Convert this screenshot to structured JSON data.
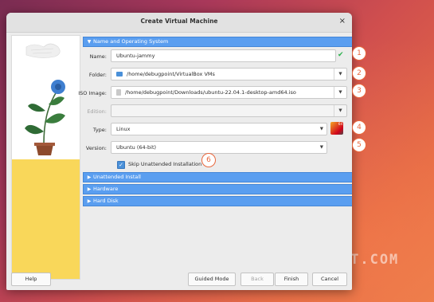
{
  "window": {
    "title": "Create Virtual Machine",
    "close_glyph": "×"
  },
  "sections": {
    "name_os": "Name and Operating System",
    "unattended": "Unattended Install",
    "hardware": "Hardware",
    "hard_disk": "Hard Disk"
  },
  "form": {
    "name_label": "Name:",
    "name_value": "Ubuntu-jammy",
    "folder_label": "Folder:",
    "folder_value": "/home/debugpoint/VirtualBox VMs",
    "iso_label": "ISO Image:",
    "iso_value": "/home/debugpoint/Downloads/ubuntu-22.04.1-desktop-amd64.iso",
    "edition_label": "Edition:",
    "edition_value": "",
    "type_label": "Type:",
    "type_value": "Linux",
    "version_label": "Version:",
    "version_value": "Ubuntu (64-bit)",
    "skip_label": "Skip Unattended Installation",
    "skip_checked": true,
    "valid_mark": "✔",
    "os_icon_text": "64"
  },
  "callouts": [
    "1",
    "2",
    "3",
    "4",
    "5",
    "6"
  ],
  "buttons": {
    "help": "Help",
    "guided": "Guided Mode",
    "back": "Back",
    "finish": "Finish",
    "cancel": "Cancel"
  },
  "watermark": "DEBUGPOINT.COM",
  "colors": {
    "accent": "#5a9ef0",
    "callout": "#e8683e",
    "valid": "#2bb24c"
  }
}
